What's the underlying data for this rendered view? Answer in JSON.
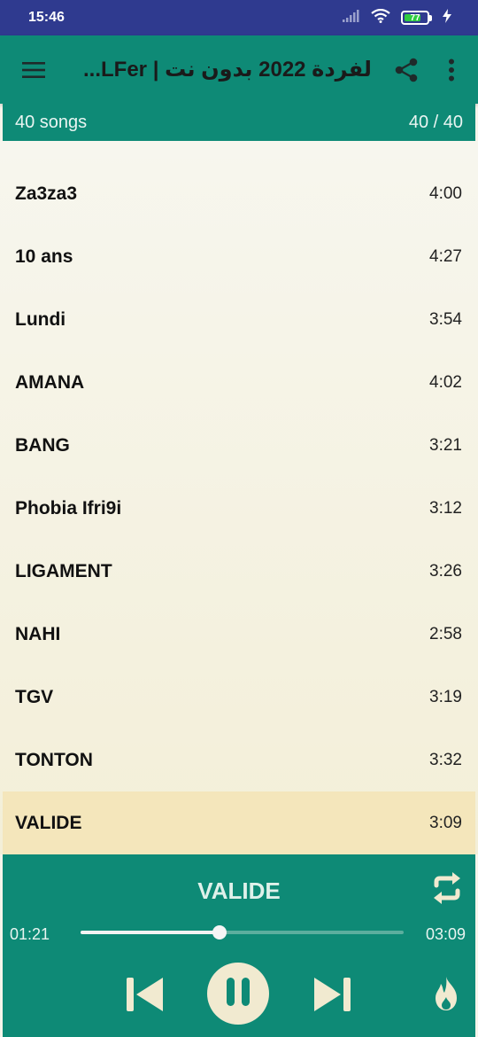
{
  "status_bar": {
    "time": "15:46",
    "battery_level": "77",
    "icons": [
      "signal-icon",
      "wifi-icon",
      "battery-icon",
      "charging-icon"
    ]
  },
  "app_bar": {
    "title": "لفردة 2022 بدون نت | LFer...",
    "menu_icon": "hamburger-menu-icon",
    "share_icon": "share-icon",
    "more_icon": "more-vert-icon"
  },
  "sub_header": {
    "song_count": "40 songs",
    "position": "40 / 40"
  },
  "songs": [
    {
      "title": "Za3za3",
      "duration": "4:00"
    },
    {
      "title": "10 ans",
      "duration": "4:27"
    },
    {
      "title": "Lundi",
      "duration": "3:54"
    },
    {
      "title": "AMANA",
      "duration": "4:02"
    },
    {
      "title": "BANG",
      "duration": "3:21"
    },
    {
      "title": "Phobia Ifri9i",
      "duration": "3:12"
    },
    {
      "title": "LIGAMENT",
      "duration": "3:26"
    },
    {
      "title": "NAHI",
      "duration": "2:58"
    },
    {
      "title": "TGV",
      "duration": "3:19"
    },
    {
      "title": "TONTON",
      "duration": "3:32"
    },
    {
      "title": "VALIDE",
      "duration": "3:09",
      "active": true
    }
  ],
  "player": {
    "now_playing": "VALIDE",
    "elapsed": "01:21",
    "total": "03:09",
    "progress": 0.43,
    "icons": [
      "repeat-icon",
      "skip-previous-icon",
      "pause-icon",
      "skip-next-icon",
      "fire-icon"
    ]
  },
  "colors": {
    "primary": "#0e8a76",
    "status_bar": "#2f3a8f",
    "active_row": "#f4e6bb",
    "play_button": "#f1ead0"
  }
}
